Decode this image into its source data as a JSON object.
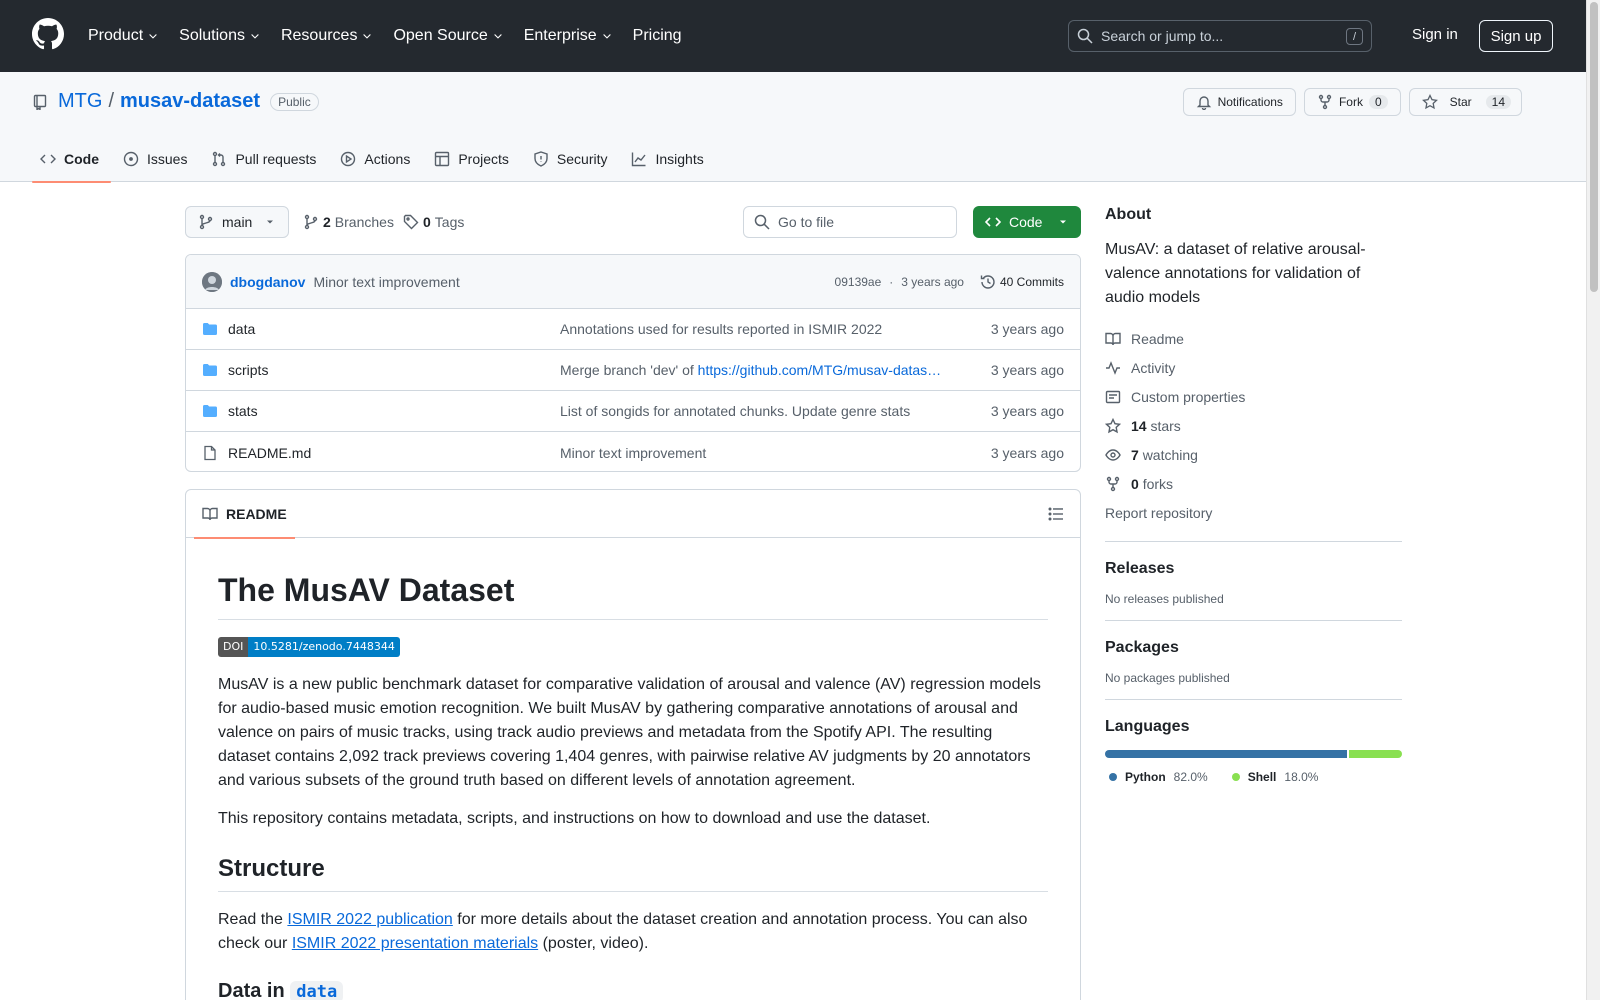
{
  "header": {
    "nav": [
      {
        "label": "Product",
        "dropdown": true
      },
      {
        "label": "Solutions",
        "dropdown": true
      },
      {
        "label": "Resources",
        "dropdown": true
      },
      {
        "label": "Open Source",
        "dropdown": true
      },
      {
        "label": "Enterprise",
        "dropdown": true
      },
      {
        "label": "Pricing",
        "dropdown": false
      }
    ],
    "search_placeholder": "Search or jump to...",
    "search_shortcut": "/",
    "sign_in": "Sign in",
    "sign_up": "Sign up"
  },
  "repo": {
    "owner": "MTG",
    "separator": "/",
    "name": "musav-dataset",
    "visibility": "Public",
    "notifications_label": "Notifications",
    "fork_label": "Fork",
    "fork_count": "0",
    "star_label": "Star",
    "star_count": "14"
  },
  "tabs": [
    {
      "label": "Code",
      "icon": "code-icon",
      "active": true
    },
    {
      "label": "Issues",
      "icon": "issue-icon",
      "active": false
    },
    {
      "label": "Pull requests",
      "icon": "pull-request-icon",
      "active": false
    },
    {
      "label": "Actions",
      "icon": "play-icon",
      "active": false
    },
    {
      "label": "Projects",
      "icon": "table-icon",
      "active": false
    },
    {
      "label": "Security",
      "icon": "shield-icon",
      "active": false
    },
    {
      "label": "Insights",
      "icon": "graph-icon",
      "active": false
    }
  ],
  "toolbar": {
    "branch": "main",
    "branches_count": "2",
    "branches_label": "Branches",
    "tags_count": "0",
    "tags_label": "Tags",
    "goto_placeholder": "Go to file",
    "code_button": "Code"
  },
  "latest_commit": {
    "author": "dbogdanov",
    "message": "Minor text improvement",
    "hash": "09139ae",
    "separator": "·",
    "time": "3 years ago",
    "commits_label": "40 Commits"
  },
  "files": [
    {
      "name": "data",
      "type": "folder",
      "message": "Annotations used for results reported in ISMIR 2022",
      "message_link": "",
      "age": "3 years ago"
    },
    {
      "name": "scripts",
      "type": "folder",
      "message": "Merge branch 'dev' of ",
      "message_link": "https://github.com/MTG/musav-datas…",
      "age": "3 years ago"
    },
    {
      "name": "stats",
      "type": "folder",
      "message": "List of songids for annotated chunks. Update genre stats",
      "message_link": "",
      "age": "3 years ago"
    },
    {
      "name": "README.md",
      "type": "file",
      "message": "Minor text improvement",
      "message_link": "",
      "age": "3 years ago"
    }
  ],
  "readme": {
    "tab_label": "README",
    "title": "The MusAV Dataset",
    "doi_label": "DOI",
    "doi_value": "10.5281/zenodo.7448344",
    "paragraph1": "MusAV is a new public benchmark dataset for comparative validation of arousal and valence (AV) regression models for audio-based music emotion recognition. We built MusAV by gathering comparative annotations of arousal and valence on pairs of music tracks, using track audio previews and metadata from the Spotify API. The resulting dataset contains 2,092 track previews covering 1,404 genres, with pairwise relative AV judgments by 20 annotators and various subsets of the ground truth based on different levels of annotation agreement.",
    "paragraph2": "This repository contains metadata, scripts, and instructions on how to download and use the dataset.",
    "structure_heading": "Structure",
    "structure_text_1": "Read the ",
    "structure_link_1": "ISMIR 2022 publication",
    "structure_text_2": " for more details about the dataset creation and annotation process. You can also check our ",
    "structure_link_2": "ISMIR 2022 presentation materials",
    "structure_text_3": " (poster, video).",
    "data_heading_prefix": "Data in ",
    "data_heading_code": "data"
  },
  "sidebar": {
    "about_title": "About",
    "description": "MusAV: a dataset of relative arousal-valence annotations for validation of audio models",
    "links": [
      {
        "icon": "book-icon",
        "count": "",
        "label": "Readme"
      },
      {
        "icon": "pulse-icon",
        "count": "",
        "label": "Activity"
      },
      {
        "icon": "note-icon",
        "count": "",
        "label": "Custom properties"
      },
      {
        "icon": "star-icon",
        "count": "14",
        "label": "stars"
      },
      {
        "icon": "eye-icon",
        "count": "7",
        "label": "watching"
      },
      {
        "icon": "fork-icon",
        "count": "0",
        "label": "forks"
      }
    ],
    "report": "Report repository",
    "releases_title": "Releases",
    "releases_text": "No releases published",
    "packages_title": "Packages",
    "packages_text": "No packages published",
    "languages_title": "Languages",
    "languages": [
      {
        "name": "Python",
        "percent": "82.0%",
        "value": 82.0,
        "color": "#3572A5"
      },
      {
        "name": "Shell",
        "percent": "18.0%",
        "value": 18.0,
        "color": "#89e051"
      }
    ]
  }
}
